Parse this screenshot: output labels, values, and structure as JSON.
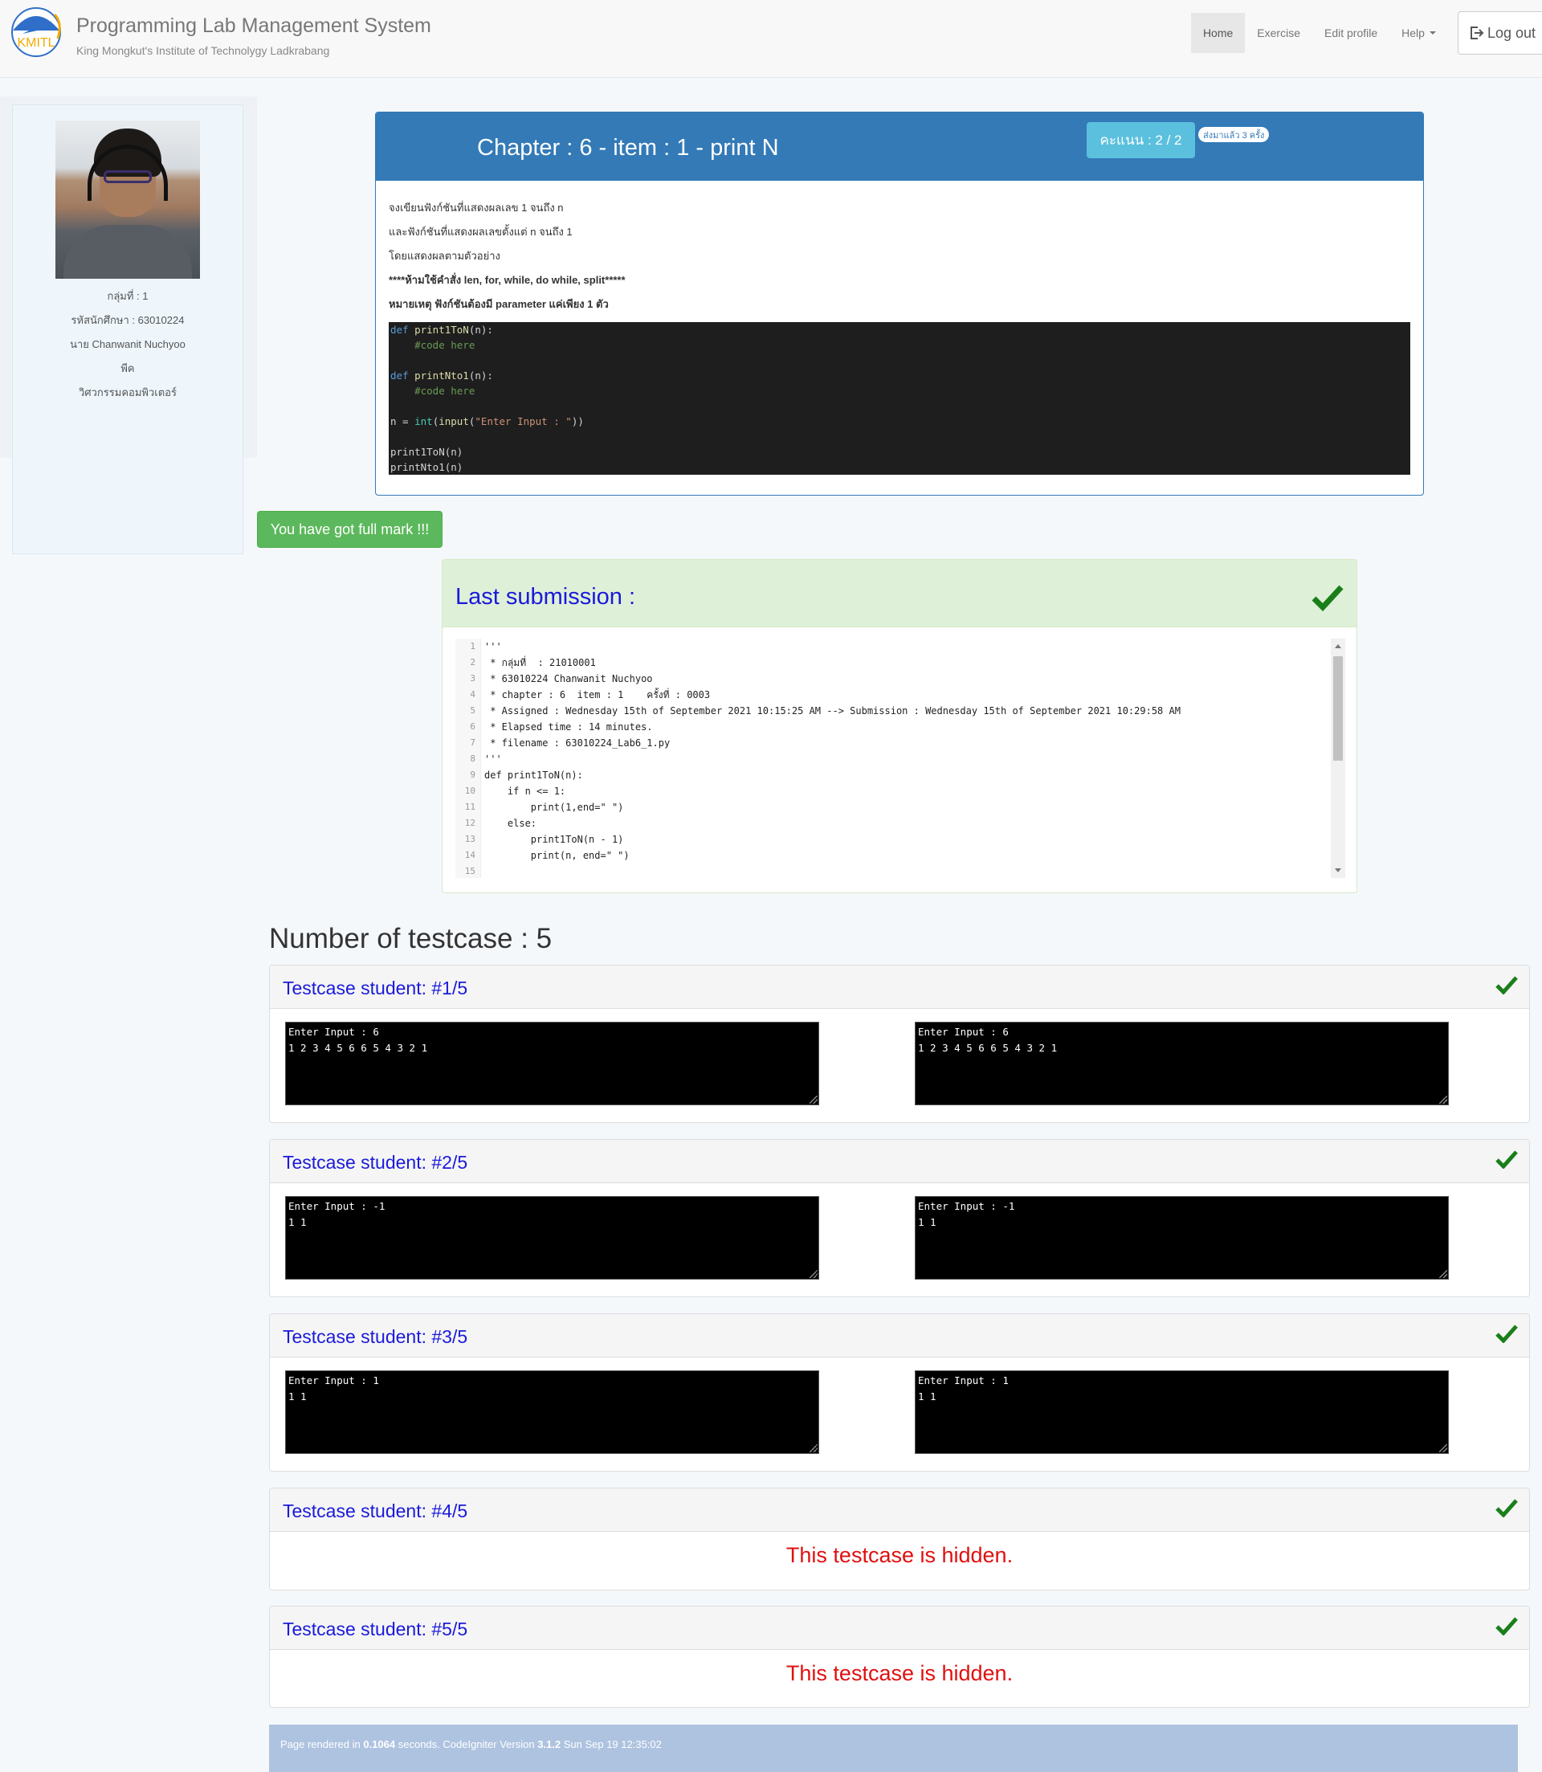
{
  "brand": {
    "title": "Programming Lab Management System",
    "subtitle": "King Mongkut's Institute of Technolygy Ladkrabang",
    "logo_text": "KMITL"
  },
  "nav": {
    "home": "Home",
    "exercise": "Exercise",
    "edit_profile": "Edit profile",
    "help": "Help",
    "logout": "Log out"
  },
  "profile": {
    "group": "กลุ่มที่ : 1",
    "student_id": "รหัสนักศึกษา : 63010224",
    "name": "นาย Chanwanit Nuchyoo",
    "nickname": "พีค",
    "faculty": "วิศวกรรมคอมพิวเตอร์"
  },
  "problem": {
    "title": "Chapter : 6 - item : 1 - print N",
    "score": "คะแนน : 2 / 2",
    "sent_count": "ส่งมาแล้ว 3 ครั้ง",
    "lines": [
      "จงเขียนฟังก์ชันที่แสดงผลเลข 1 จนถึง n",
      "และฟังก์ชันที่แสดงผลเลขตั้งแต่ n จนถึง 1",
      "โดยแสดงผลตามตัวอย่าง",
      "****ห้ามใช้คำสั่ง len, for, while, do while, split*****",
      "หมายเหตุ ฟังก์ชันต้องมี parameter แค่เพียง 1 ตัว"
    ],
    "code": {
      "l1_kw": "def",
      "l1_fn": " print1ToN",
      "l1_rest": "(n):",
      "l2": "    #code here",
      "l4_kw": "def",
      "l4_fn": " printNto1",
      "l4_rest": "(n):",
      "l5": "    #code here",
      "l7_a": "n = ",
      "l7_int": "int",
      "l7_b": "(",
      "l7_input": "input",
      "l7_c": "(",
      "l7_str": "\"Enter Input : \"",
      "l7_d": "))",
      "l9": "print1ToN(n)",
      "l10": "printNto1(n)"
    }
  },
  "full_mark": "You have got full mark !!!",
  "submission": {
    "title": "Last submission :",
    "line_numbers": [
      "1",
      "2",
      "3",
      "4",
      "5",
      "6",
      "7",
      "8",
      "9",
      "10",
      "11",
      "12",
      "13",
      "14",
      "15"
    ],
    "lines": [
      "'''",
      " * กลุ่มที่  : 21010001",
      " * 63010224 Chanwanit Nuchyoo",
      " * chapter : 6  item : 1    ครั้งที่ : 0003",
      " * Assigned : Wednesday 15th of September 2021 10:15:25 AM --> Submission : Wednesday 15th of September 2021 10:29:58 AM",
      " * Elapsed time : 14 minutes.",
      " * filename : 63010224_Lab6_1.py",
      "'''",
      "def print1ToN(n):",
      "    if n <= 1:",
      "        print(1,end=\" \")",
      "    else:",
      "        print1ToN(n - 1)",
      "        print(n, end=\" \")",
      ""
    ]
  },
  "testcase_count": "Number of testcase : 5",
  "testcases": [
    {
      "title": "Testcase student: #1/5",
      "expected": "Enter Input : 6\n1 2 3 4 5 6 6 5 4 3 2 1",
      "actual": "Enter Input : 6\n1 2 3 4 5 6 6 5 4 3 2 1"
    },
    {
      "title": "Testcase student: #2/5",
      "expected": "Enter Input : -1\n1 1",
      "actual": "Enter Input : -1\n1 1"
    },
    {
      "title": "Testcase student: #3/5",
      "expected": "Enter Input : 1\n1 1",
      "actual": "Enter Input : 1\n1 1"
    },
    {
      "title": "Testcase student: #4/5",
      "hidden": "This testcase is hidden."
    },
    {
      "title": "Testcase student: #5/5",
      "hidden": "This testcase is hidden."
    }
  ],
  "footer": {
    "a": "Page rendered in ",
    "time": "0.1064",
    "b": " seconds. CodeIgniter Version ",
    "version": "3.1.2",
    "c": " Sun Sep 19 12:35:02"
  },
  "colors": {
    "primary": "#337ab7",
    "success": "#5cb85c",
    "info": "#5bc0de",
    "check": "#1a7f1a",
    "link_blue": "#1a1adb",
    "hidden_red": "#e01010"
  }
}
